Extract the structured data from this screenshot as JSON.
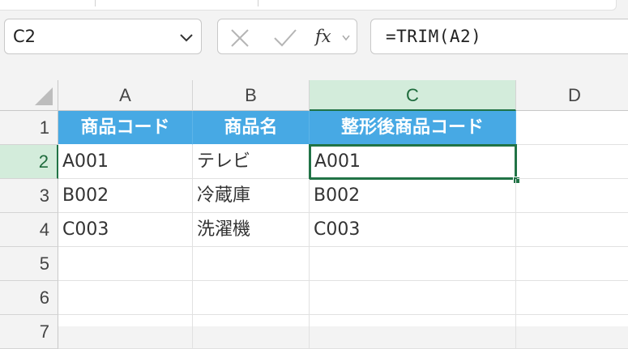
{
  "name_box": {
    "value": "C2"
  },
  "formula_bar": {
    "value": "=TRIM(A2)",
    "fx_label": "fx"
  },
  "columns": [
    "A",
    "B",
    "C",
    "D"
  ],
  "rows": [
    "1",
    "2",
    "3",
    "4",
    "5",
    "6",
    "7"
  ],
  "selected": {
    "column": "C",
    "row": "2"
  },
  "table": {
    "headers": [
      "商品コード",
      "商品名",
      "整形後商品コード"
    ],
    "rows": [
      [
        "A001",
        "テレビ",
        "A001"
      ],
      [
        "B002",
        "冷蔵庫",
        "B002"
      ],
      [
        "C003",
        "洗濯機",
        "C003"
      ]
    ]
  },
  "colors": {
    "header_fill": "#47a9e4",
    "selection": "#217346",
    "selection_header_fill": "#d3ecdb"
  }
}
